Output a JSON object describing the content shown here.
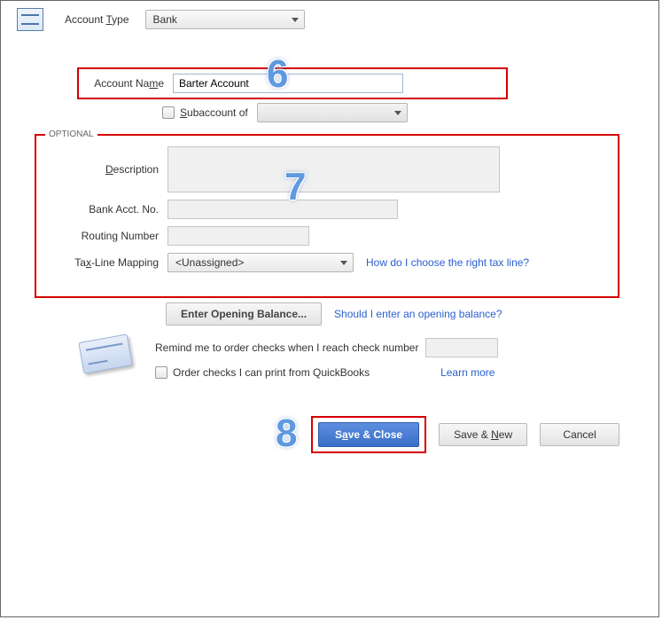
{
  "header": {
    "account_type_label_pre": "Account ",
    "account_type_label_u": "T",
    "account_type_label_post": "ype",
    "account_type_value": "Bank"
  },
  "name_section": {
    "label_pre": "Account Na",
    "label_u": "m",
    "label_post": "e",
    "value": "Barter Account",
    "sub_checkbox_pre": "",
    "sub_checkbox_u": "S",
    "sub_checkbox_post": "ubaccount of",
    "sub_value": ""
  },
  "optional": {
    "legend": "OPTIONAL",
    "desc_label_u": "D",
    "desc_label_post": "escription",
    "desc_value": "",
    "bank_no_label": "Bank Acct. No.",
    "bank_no_value": "",
    "routing_label": "Routing Number",
    "routing_value": "",
    "tax_label_pre": "Ta",
    "tax_label_u": "x",
    "tax_label_post": "-Line Mapping",
    "tax_value": "<Unassigned>",
    "tax_help": "How do I choose the right tax line?"
  },
  "opening": {
    "button": "Enter Opening Balance...",
    "help": "Should I enter an opening balance?"
  },
  "checks": {
    "remind_text": "Remind me to order checks when I reach check number",
    "remind_value": "",
    "order_text": "Order checks I can print from QuickBooks",
    "learn_more": "Learn more"
  },
  "buttons": {
    "save_close_pre": "S",
    "save_close_u": "a",
    "save_close_post": "ve & Close",
    "save_new_pre": "Save & ",
    "save_new_u": "N",
    "save_new_post": "ew",
    "cancel": "Cancel"
  },
  "annotations": {
    "a6": "6",
    "a7": "7",
    "a8": "8"
  }
}
